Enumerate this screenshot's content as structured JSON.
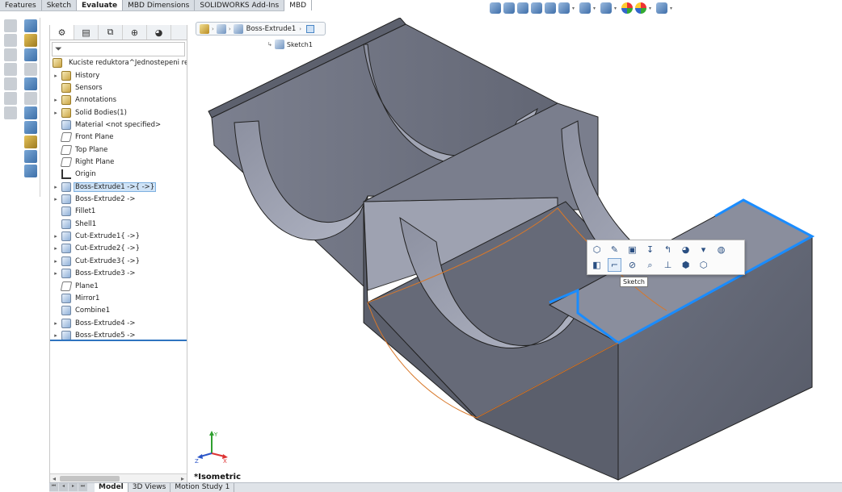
{
  "command_manager": {
    "tabs": [
      "Features",
      "Sketch",
      "Evaluate",
      "MBD Dimensions",
      "SOLIDWORKS Add-Ins",
      "MBD"
    ],
    "active_tab": "Evaluate"
  },
  "feature_manager": {
    "root_label": "Kuciste reduktora^Jednostepeni reduk",
    "tree": [
      {
        "label": "History",
        "expand": true,
        "icon": "history-folder-icon"
      },
      {
        "label": "Sensors",
        "expand": false,
        "icon": "sensors-folder-icon"
      },
      {
        "label": "Annotations",
        "expand": true,
        "icon": "annotations-folder-icon"
      },
      {
        "label": "Solid Bodies(1)",
        "expand": true,
        "icon": "solid-bodies-folder-icon"
      },
      {
        "label": "Material <not specified>",
        "expand": false,
        "icon": "material-icon"
      },
      {
        "label": "Front Plane",
        "expand": false,
        "icon": "plane-icon"
      },
      {
        "label": "Top Plane",
        "expand": false,
        "icon": "plane-icon"
      },
      {
        "label": "Right Plane",
        "expand": false,
        "icon": "plane-icon"
      },
      {
        "label": "Origin",
        "expand": false,
        "icon": "origin-icon"
      },
      {
        "label": "Boss-Extrude1 ->{ ->}",
        "expand": true,
        "icon": "extrude-icon",
        "selected": true
      },
      {
        "label": "Boss-Extrude2 ->",
        "expand": true,
        "icon": "extrude-icon"
      },
      {
        "label": "Fillet1",
        "expand": false,
        "icon": "fillet-icon"
      },
      {
        "label": "Shell1",
        "expand": false,
        "icon": "shell-icon"
      },
      {
        "label": "Cut-Extrude1{ ->}",
        "expand": true,
        "icon": "cut-extrude-icon"
      },
      {
        "label": "Cut-Extrude2{ ->}",
        "expand": true,
        "icon": "cut-extrude-icon"
      },
      {
        "label": "Cut-Extrude3{ ->}",
        "expand": true,
        "icon": "cut-extrude-icon"
      },
      {
        "label": "Boss-Extrude3 ->",
        "expand": true,
        "icon": "extrude-icon"
      },
      {
        "label": "Plane1",
        "expand": false,
        "icon": "plane-icon"
      },
      {
        "label": "Mirror1",
        "expand": false,
        "icon": "mirror-icon"
      },
      {
        "label": "Combine1",
        "expand": false,
        "icon": "combine-icon"
      },
      {
        "label": "Boss-Extrude4 ->",
        "expand": true,
        "icon": "extrude-icon"
      },
      {
        "label": "Boss-Extrude5 ->",
        "expand": true,
        "icon": "extrude-icon"
      }
    ]
  },
  "breadcrumb": {
    "feature": "Boss-Extrude1",
    "sketch": "Sketch1"
  },
  "context_toolbar": {
    "tooltip": "Sketch",
    "row1": [
      "normal-to-icon",
      "edit-feature-icon",
      "edit-sketch-icon",
      "rollback-icon",
      "parent-child-icon",
      "appearance-icon",
      "appearance-dropdown-icon",
      "color-icon"
    ],
    "row2": [
      "hide-icon",
      "sketch-icon",
      "zoom-to-selection-icon",
      "zoom-icon",
      "normal-to-plane-icon",
      "isometric-icon",
      "view-orientation-icon"
    ]
  },
  "viewport": {
    "view_name": "*Isometric",
    "triad": {
      "x": "X",
      "y": "Y",
      "z": "Z"
    }
  },
  "bottom_tabs": [
    "Model",
    "3D Views",
    "Motion Study 1"
  ],
  "colors": {
    "model_face": "#6b6f7c",
    "model_top": "#9a9eae",
    "selection_edge": "#1a8cff",
    "sketch_edge": "#d8782a"
  }
}
